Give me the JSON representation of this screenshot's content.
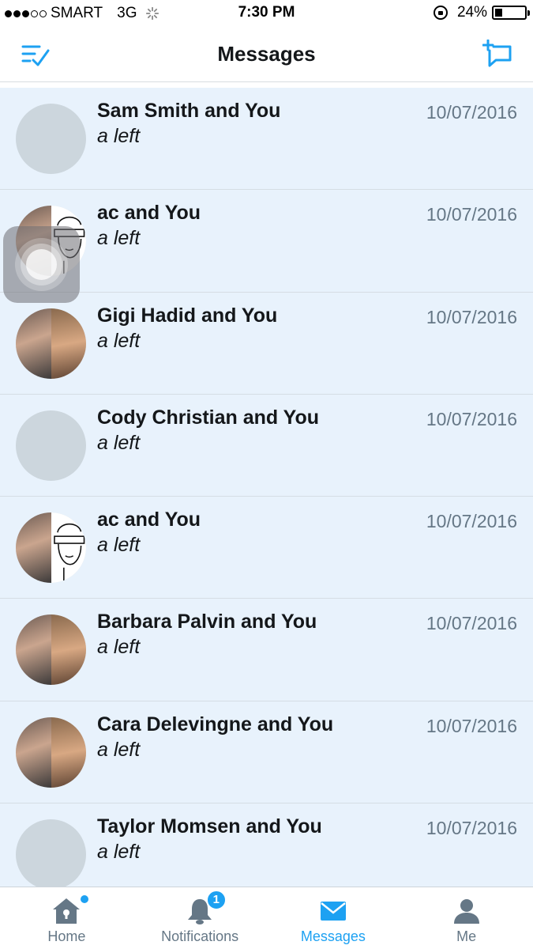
{
  "status_bar": {
    "carrier": "SMART",
    "network": "3G",
    "time": "7:30 PM",
    "battery": "24%",
    "battery_level": 0.24,
    "signal_bars_filled": 3,
    "signal_bars_total": 5
  },
  "header": {
    "title": "Messages",
    "left_icon": "mark-read-icon",
    "right_icon": "compose-message-icon"
  },
  "conversations": [
    {
      "name": "Sam Smith and You",
      "preview": "a left",
      "date": "10/07/2016",
      "avatar": "placeholder"
    },
    {
      "name": "ac and You",
      "preview": "a left",
      "date": "10/07/2016",
      "avatar": "split-sketch"
    },
    {
      "name": "Gigi Hadid and You",
      "preview": "a left",
      "date": "10/07/2016",
      "avatar": "split-photo"
    },
    {
      "name": "Cody Christian and You",
      "preview": "a left",
      "date": "10/07/2016",
      "avatar": "placeholder"
    },
    {
      "name": "ac and You",
      "preview": "a left",
      "date": "10/07/2016",
      "avatar": "split-sketch"
    },
    {
      "name": "Barbara Palvin and You",
      "preview": "a left",
      "date": "10/07/2016",
      "avatar": "split-photo"
    },
    {
      "name": "Cara Delevingne and You",
      "preview": "a left",
      "date": "10/07/2016",
      "avatar": "split-photo"
    },
    {
      "name": "Taylor Momsen and You",
      "preview": "a left",
      "date": "10/07/2016",
      "avatar": "placeholder"
    }
  ],
  "tabs": [
    {
      "label": "Home",
      "icon": "home-icon",
      "active": false
    },
    {
      "label": "Notifications",
      "icon": "bell-icon",
      "active": false,
      "badge": "1"
    },
    {
      "label": "Messages",
      "icon": "envelope-icon",
      "active": true
    },
    {
      "label": "Me",
      "icon": "person-icon",
      "active": false
    }
  ],
  "colors": {
    "accent": "#1da1f2",
    "row_background": "#e8f2fc",
    "secondary_text": "#657786",
    "placeholder_avatar": "#ccd6dd"
  }
}
